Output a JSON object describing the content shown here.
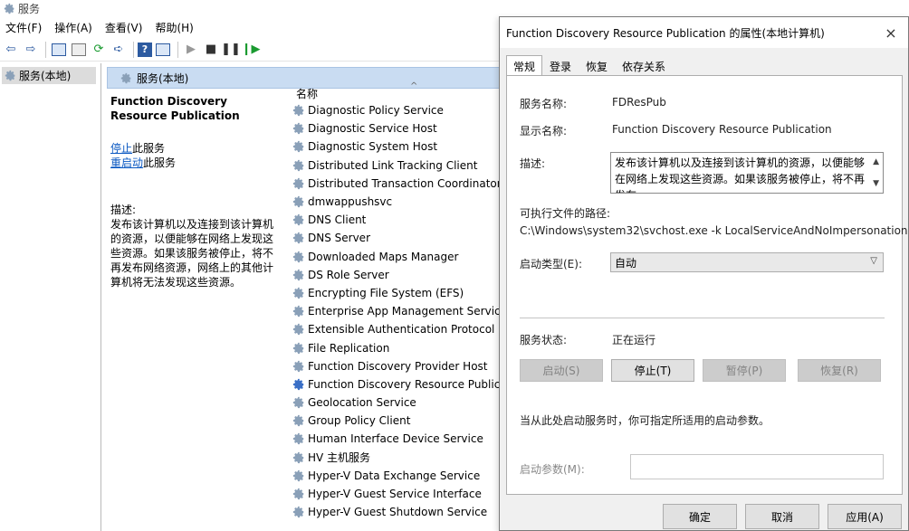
{
  "window": {
    "title": "服务"
  },
  "menubar": [
    "文件(F)",
    "操作(A)",
    "查看(V)",
    "帮助(H)"
  ],
  "tree": {
    "root": "服务(本地)"
  },
  "panel": {
    "tab_label": "服务(本地)",
    "service_name": "Function Discovery Resource Publication",
    "stop_link": "停止",
    "stop_suffix": "此服务",
    "restart_link": "重启动",
    "restart_suffix": "此服务",
    "desc_label": "描述:",
    "description": "发布该计算机以及连接到该计算机的资源，以便能够在网络上发现这些资源。如果该服务被停止，将不再发布网络资源，网络上的其他计算机将无法发现这些资源。"
  },
  "list": {
    "header": "名称",
    "selected_index": 15,
    "rows": [
      "Diagnostic Policy Service",
      "Diagnostic Service Host",
      "Diagnostic System Host",
      "Distributed Link Tracking Client",
      "Distributed Transaction Coordinator",
      "dmwappushsvc",
      "DNS Client",
      "DNS Server",
      "Downloaded Maps Manager",
      "DS Role Server",
      "Encrypting File System (EFS)",
      "Enterprise App Management Service",
      "Extensible Authentication Protocol",
      "File Replication",
      "Function Discovery Provider Host",
      "Function Discovery Resource Publicati",
      "Geolocation Service",
      "Group Policy Client",
      "Human Interface Device Service",
      "HV 主机服务",
      "Hyper-V Data Exchange Service",
      "Hyper-V Guest Service Interface",
      "Hyper-V Guest Shutdown Service"
    ]
  },
  "dialog": {
    "title": "Function Discovery Resource Publication 的属性(本地计算机)",
    "close": "×",
    "tabs": [
      "常规",
      "登录",
      "恢复",
      "依存关系"
    ],
    "service_name_label": "服务名称:",
    "service_name_value": "FDResPub",
    "display_name_label": "显示名称:",
    "display_name_value": "Function Discovery Resource Publication",
    "desc_label": "描述:",
    "desc_value": "发布该计算机以及连接到该计算机的资源，以便能够在网络上发现这些资源。如果该服务被停止，将不再发布",
    "path_label": "可执行文件的路径:",
    "path_value": "C:\\Windows\\system32\\svchost.exe -k LocalServiceAndNoImpersonation",
    "startup_type_label": "启动类型(E):",
    "startup_type_value": "自动",
    "status_label": "服务状态:",
    "status_value": "正在运行",
    "start_btn": "启动(S)",
    "stop_btn": "停止(T)",
    "pause_btn": "暂停(P)",
    "resume_btn": "恢复(R)",
    "note": "当从此处启动服务时，你可指定所适用的启动参数。",
    "params_label": "启动参数(M):",
    "ok_btn": "确定",
    "cancel_btn": "取消",
    "apply_btn": "应用(A)"
  }
}
